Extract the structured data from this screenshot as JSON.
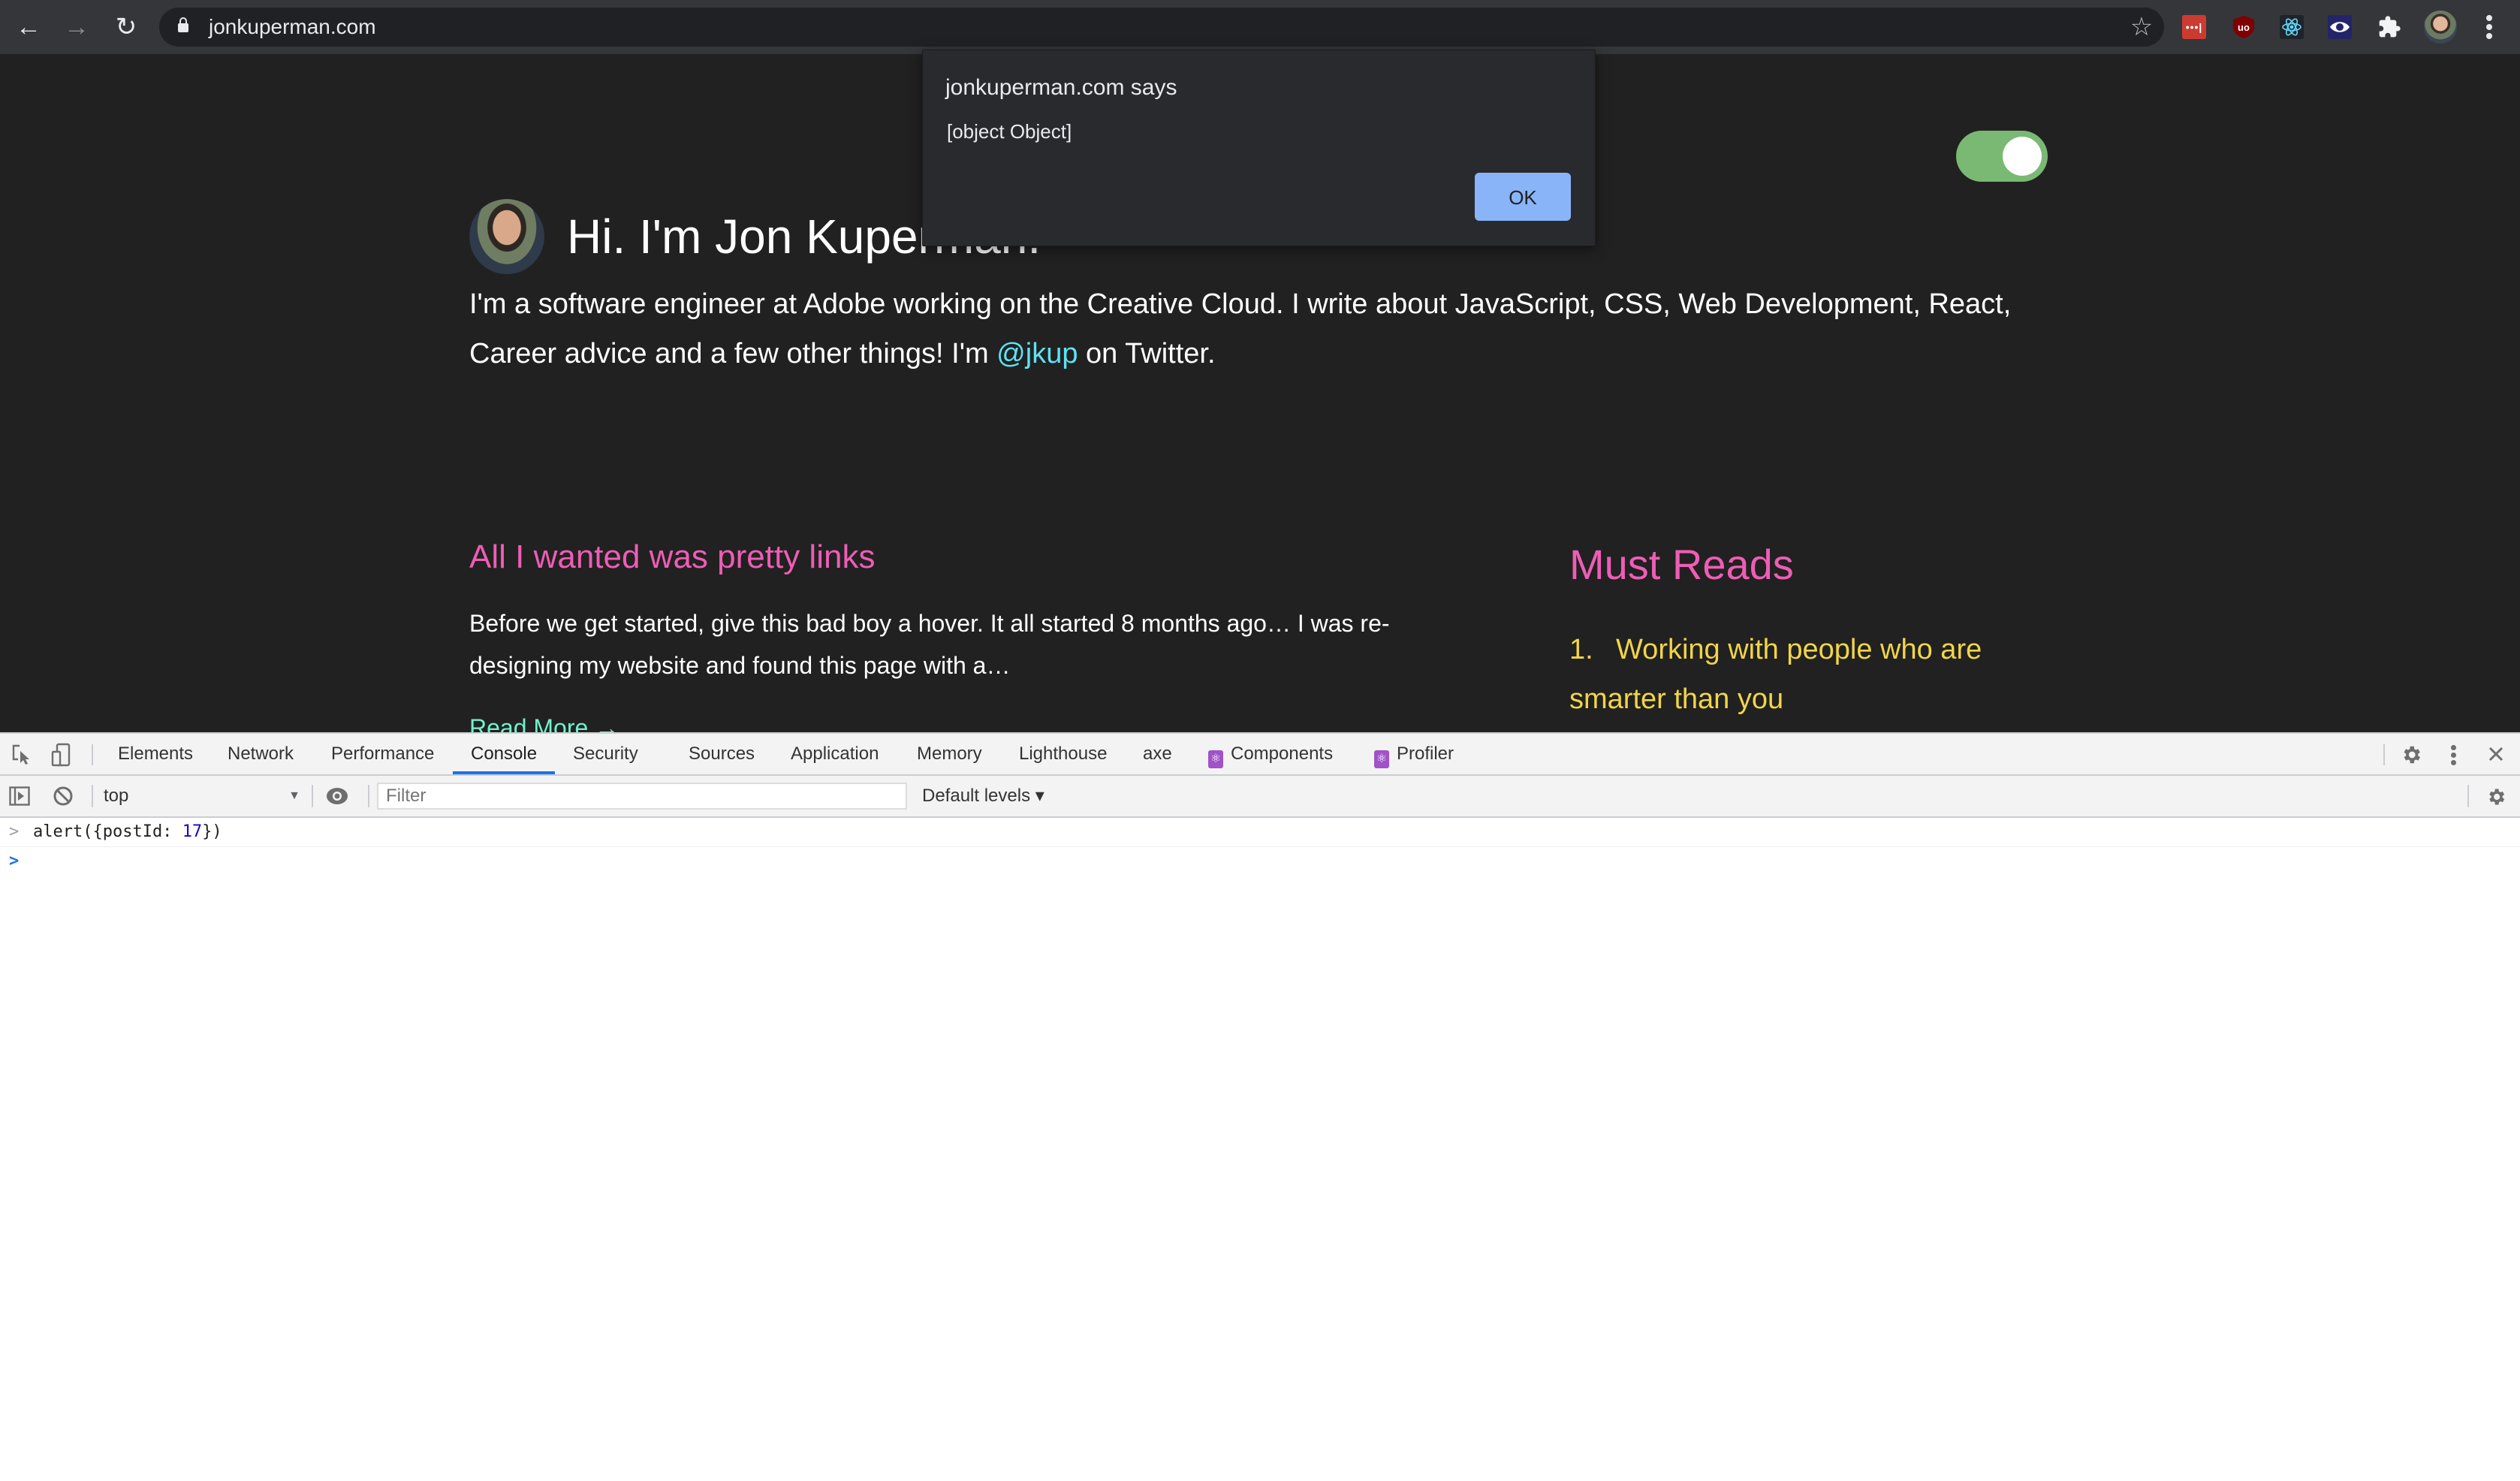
{
  "browser": {
    "url": "jonkuperman.com",
    "nav": {
      "back_icon": "←",
      "forward_icon": "→",
      "reload_icon": "↻"
    },
    "bookmark_icon": "☆",
    "extensions": [
      {
        "name": "LastPass",
        "label": "•••|"
      },
      {
        "name": "uBlock Origin",
        "label": "uo"
      },
      {
        "name": "React Developer Tools",
        "label": ""
      },
      {
        "name": "Accessibility Insights",
        "label": ""
      },
      {
        "name": "Extensions",
        "label": ""
      }
    ]
  },
  "dialog": {
    "title": "jonkuperman.com says",
    "message": "[object Object]",
    "ok_label": "OK"
  },
  "page": {
    "heading": "Hi. I'm Jon Kuperman.",
    "intro_before": "I'm a software engineer at Adobe working on the Creative Cloud. I write about JavaScript, CSS, Web Development, React, Career advice and a few other things! I'm ",
    "twitter_handle": "@jkup",
    "intro_after": " on Twitter.",
    "theme_toggle_on": true,
    "post": {
      "title": "All I wanted was pretty links",
      "excerpt": "Before we get started, give this bad boy a hover. It all started 8 months ago… I was re-designing my website and found this page with a…",
      "read_more": "Read More →"
    },
    "must_reads": {
      "title": "Must Reads",
      "items": [
        {
          "number": "1.",
          "label": "Working with people who are smarter than you"
        }
      ]
    },
    "colors": {
      "background": "#212121",
      "accent_pink": "#ee5db5",
      "link_cyan": "#5ee2f2",
      "read_more_green": "#6ff2cc",
      "must_reads_yellow": "#f1d548",
      "toggle_green": "#7ab973"
    }
  },
  "devtools": {
    "tabs": [
      {
        "label": "Elements",
        "active": false
      },
      {
        "label": "Network",
        "active": false
      },
      {
        "label": "Performance",
        "active": false
      },
      {
        "label": "Console",
        "active": true
      },
      {
        "label": "Security",
        "active": false
      },
      {
        "label": "Sources",
        "active": false
      },
      {
        "label": "Application",
        "active": false
      },
      {
        "label": "Memory",
        "active": false
      },
      {
        "label": "Lighthouse",
        "active": false
      },
      {
        "label": "axe",
        "active": false
      },
      {
        "label": "Components",
        "active": false,
        "icon": "react-icon"
      },
      {
        "label": "Profiler",
        "active": false,
        "icon": "react-icon"
      }
    ],
    "console_toolbar": {
      "context": "top",
      "filter_placeholder": "Filter",
      "filter_value": "",
      "levels": "Default levels ▾"
    },
    "console": {
      "entries": [
        {
          "prompt": ">",
          "code_before": "alert({postId: ",
          "number": "17",
          "code_after": "})"
        }
      ],
      "input_prompt": ">"
    }
  }
}
